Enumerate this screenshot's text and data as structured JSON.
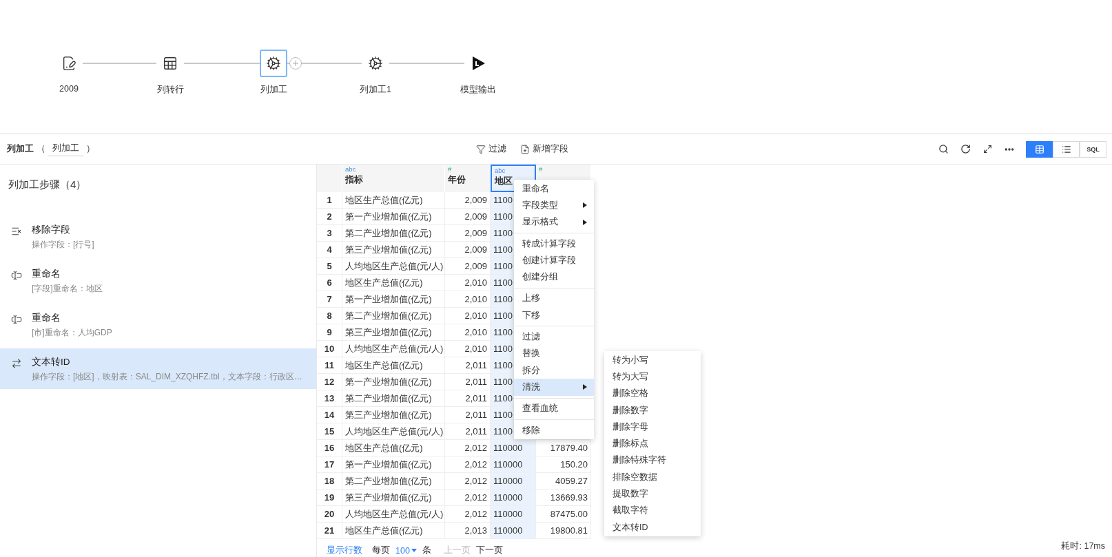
{
  "flow": {
    "nodes": [
      {
        "label": "2009",
        "kind": "note",
        "selected": false
      },
      {
        "label": "列转行",
        "kind": "pivot",
        "selected": false
      },
      {
        "label": "列加工",
        "kind": "gear",
        "selected": true
      },
      {
        "label": "列加工1",
        "kind": "gear",
        "selected": false
      },
      {
        "label": "模型输出",
        "kind": "output",
        "selected": false
      }
    ]
  },
  "toolbar": {
    "title": "列加工",
    "open": "（",
    "name": "列加工",
    "close": "）",
    "actions": [
      {
        "label": "过滤",
        "kind": "filter"
      },
      {
        "label": "新增字段",
        "kind": "add"
      }
    ],
    "views": [
      {
        "kind": "table",
        "selected": true
      },
      {
        "kind": "list",
        "selected": false
      },
      {
        "kind": "sql",
        "label": "SQL",
        "selected": false
      }
    ]
  },
  "steps": {
    "title": "列加工步骤（4）",
    "items": [
      {
        "name": "移除字段",
        "detail": "操作字段：[行号]",
        "kind": "remove",
        "selected": false
      },
      {
        "name": "重命名",
        "detail": "[字段]重命名：地区",
        "kind": "rename",
        "selected": false
      },
      {
        "name": "重命名",
        "detail": "[市]重命名：人均GDP",
        "kind": "rename",
        "selected": false
      },
      {
        "name": "文本转ID",
        "detail": "操作字段：[地区]，映射表：SAL_DIM_XZQHFZ.tbl，文本字段：行政区…",
        "kind": "convert",
        "selected": true
      }
    ]
  },
  "table": {
    "columns": [
      {
        "type": "abc",
        "name": "指标",
        "selected": false
      },
      {
        "type": "#",
        "name": "年份",
        "selected": false
      },
      {
        "type": "abc",
        "name": "地区",
        "selected": true
      },
      {
        "type": "#",
        "selected": false
      }
    ],
    "rows": [
      {
        "num": "1",
        "cells": [
          "地区生产总值(亿元)",
          "2,009",
          "1100"
        ]
      },
      {
        "num": "2",
        "cells": [
          "第一产业增加值(亿元)",
          "2,009",
          "1100"
        ]
      },
      {
        "num": "3",
        "cells": [
          "第二产业增加值(亿元)",
          "2,009",
          "1100"
        ]
      },
      {
        "num": "4",
        "cells": [
          "第三产业增加值(亿元)",
          "2,009",
          "1100"
        ]
      },
      {
        "num": "5",
        "cells": [
          "人均地区生产总值(元/人)",
          "2,009",
          "1100"
        ]
      },
      {
        "num": "6",
        "cells": [
          "地区生产总值(亿元)",
          "2,010",
          "1100"
        ]
      },
      {
        "num": "7",
        "cells": [
          "第一产业增加值(亿元)",
          "2,010",
          "1100"
        ]
      },
      {
        "num": "8",
        "cells": [
          "第二产业增加值(亿元)",
          "2,010",
          "1100"
        ]
      },
      {
        "num": "9",
        "cells": [
          "第三产业增加值(亿元)",
          "2,010",
          "1100"
        ]
      },
      {
        "num": "10",
        "cells": [
          "人均地区生产总值(元/人)",
          "2,010",
          "1100"
        ]
      },
      {
        "num": "11",
        "cells": [
          "地区生产总值(亿元)",
          "2,011",
          "1100"
        ]
      },
      {
        "num": "12",
        "cells": [
          "第一产业增加值(亿元)",
          "2,011",
          "1100"
        ]
      },
      {
        "num": "13",
        "cells": [
          "第二产业增加值(亿元)",
          "2,011",
          "1100"
        ]
      },
      {
        "num": "14",
        "cells": [
          "第三产业增加值(亿元)",
          "2,011",
          "1100"
        ]
      },
      {
        "num": "15",
        "cells": [
          "人均地区生产总值(元/人)",
          "2,011",
          "1100"
        ]
      },
      {
        "num": "16",
        "cells": [
          "地区生产总值(亿元)",
          "2,012",
          "110000",
          "17879.40"
        ]
      },
      {
        "num": "17",
        "cells": [
          "第一产业增加值(亿元)",
          "2,012",
          "110000",
          "150.20"
        ]
      },
      {
        "num": "18",
        "cells": [
          "第二产业增加值(亿元)",
          "2,012",
          "110000",
          "4059.27"
        ]
      },
      {
        "num": "19",
        "cells": [
          "第三产业增加值(亿元)",
          "2,012",
          "110000",
          "13669.93"
        ]
      },
      {
        "num": "20",
        "cells": [
          "人均地区生产总值(元/人)",
          "2,012",
          "110000",
          "87475.00"
        ]
      },
      {
        "num": "21",
        "cells": [
          "地区生产总值(亿元)",
          "2,013",
          "110000",
          "19800.81"
        ]
      }
    ]
  },
  "context_menu": {
    "groups": [
      [
        {
          "label": "重命名",
          "submenu": false,
          "selected": false
        },
        {
          "label": "字段类型",
          "submenu": true,
          "selected": false
        },
        {
          "label": "显示格式",
          "submenu": true,
          "selected": false
        }
      ],
      [
        {
          "label": "转成计算字段",
          "submenu": false,
          "selected": false
        },
        {
          "label": "创建计算字段",
          "submenu": false,
          "selected": false
        },
        {
          "label": "创建分组",
          "submenu": false,
          "selected": false
        }
      ],
      [
        {
          "label": "上移",
          "submenu": false,
          "selected": false
        },
        {
          "label": "下移",
          "submenu": false,
          "selected": false
        }
      ],
      [
        {
          "label": "过滤",
          "submenu": false,
          "selected": false
        },
        {
          "label": "替换",
          "submenu": false,
          "selected": false
        },
        {
          "label": "拆分",
          "submenu": false,
          "selected": false
        },
        {
          "label": "清洗",
          "submenu": true,
          "selected": true
        }
      ],
      [
        {
          "label": "查看血统",
          "submenu": false,
          "selected": false
        }
      ],
      [
        {
          "label": "移除",
          "submenu": false,
          "selected": false
        }
      ]
    ],
    "submenu": [
      "转为小写",
      "转为大写",
      "删除空格",
      "删除数字",
      "删除字母",
      "删除标点",
      "删除特殊字符",
      "排除空数据",
      "提取数字",
      "截取字符",
      "文本转ID"
    ]
  },
  "pager": {
    "show_rows": "显示行数",
    "per_page": "每页",
    "size": "100",
    "unit": "条",
    "prev": {
      "label": "上一页",
      "disabled": true
    },
    "next": {
      "label": "下一页",
      "disabled": false
    }
  },
  "elapsed": "耗时: 17ms"
}
